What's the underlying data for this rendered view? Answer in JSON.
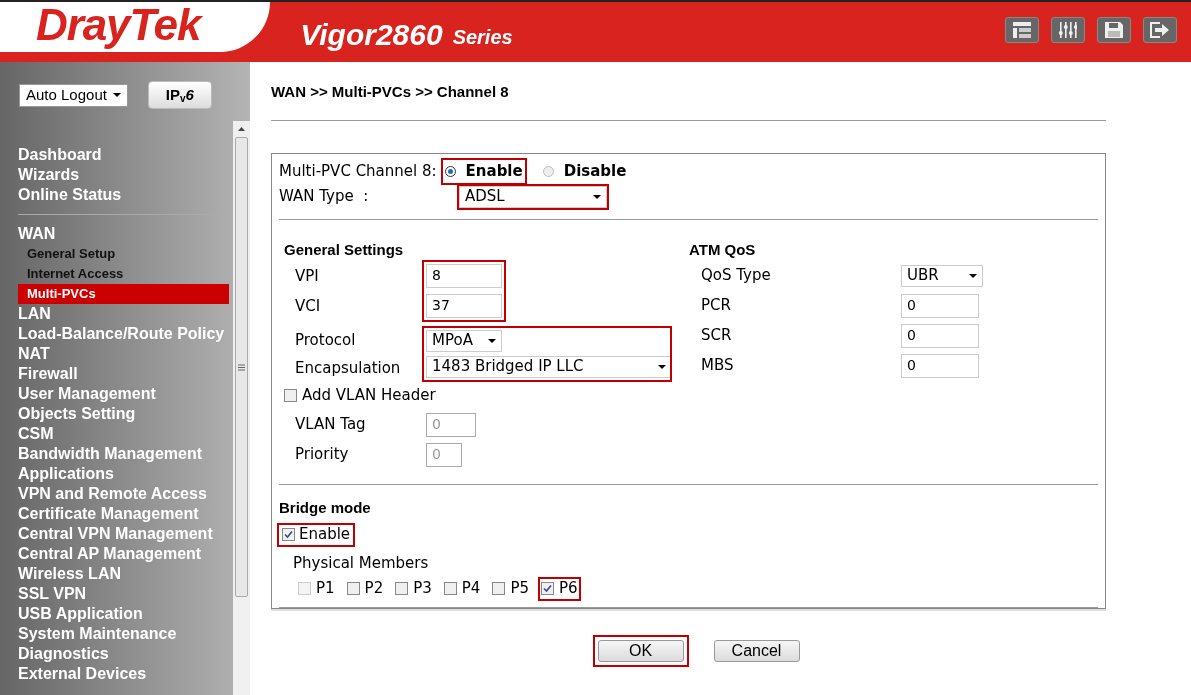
{
  "header": {
    "brand": "DrayTek",
    "model": "Vigor2860",
    "series": "Series"
  },
  "sidebar": {
    "auto_logout": "Auto Logout",
    "ipv6_button": "IP$_{v}$*6*",
    "items": [
      {
        "label": "Dashboard",
        "kind": "main",
        "selected": false
      },
      {
        "label": "Wizards",
        "kind": "main",
        "selected": false
      },
      {
        "label": "Online Status",
        "kind": "main",
        "selected": false
      },
      {
        "kind": "divider"
      },
      {
        "label": "WAN",
        "kind": "main",
        "selected": false
      },
      {
        "label": "General Setup",
        "kind": "sub",
        "selected": false
      },
      {
        "label": "Internet Access",
        "kind": "sub",
        "selected": false
      },
      {
        "label": "Multi-PVCs",
        "kind": "sub",
        "selected": true
      },
      {
        "label": "LAN",
        "kind": "main",
        "selected": false
      },
      {
        "label": "Load-Balance/Route Policy",
        "kind": "main",
        "selected": false
      },
      {
        "label": "NAT",
        "kind": "main",
        "selected": false
      },
      {
        "label": "Firewall",
        "kind": "main",
        "selected": false
      },
      {
        "label": "User Management",
        "kind": "main",
        "selected": false
      },
      {
        "label": "Objects Setting",
        "kind": "main",
        "selected": false
      },
      {
        "label": "CSM",
        "kind": "main",
        "selected": false
      },
      {
        "label": "Bandwidth Management",
        "kind": "main",
        "selected": false
      },
      {
        "label": "Applications",
        "kind": "main",
        "selected": false
      },
      {
        "label": "VPN and Remote Access",
        "kind": "main",
        "selected": false
      },
      {
        "label": "Certificate Management",
        "kind": "main",
        "selected": false
      },
      {
        "label": "Central VPN Management",
        "kind": "main",
        "selected": false
      },
      {
        "label": "Central AP Management",
        "kind": "main",
        "selected": false
      },
      {
        "label": "Wireless LAN",
        "kind": "main",
        "selected": false
      },
      {
        "label": "SSL VPN",
        "kind": "main",
        "selected": false
      },
      {
        "label": "USB Application",
        "kind": "main",
        "selected": false
      },
      {
        "label": "System Maintenance",
        "kind": "main",
        "selected": false
      },
      {
        "label": "Diagnostics",
        "kind": "main",
        "selected": false
      },
      {
        "label": "External Devices",
        "kind": "main",
        "selected": false
      }
    ]
  },
  "breadcrumb": "WAN >> Multi-PVCs >> Channel 8",
  "channel": {
    "label": "Multi-PVC Channel 8:",
    "options": [
      {
        "label": "Enable",
        "selected": true,
        "highlighted": true
      },
      {
        "label": "Disable",
        "selected": false,
        "highlighted": false
      }
    ]
  },
  "wan_type": {
    "label": "WAN Type  :",
    "value": "ADSL",
    "highlighted": true
  },
  "general": {
    "title": "General Settings",
    "vpi": {
      "label": "VPI",
      "value": "8"
    },
    "vci": {
      "label": "VCI",
      "value": "37"
    },
    "protocol": {
      "label": "Protocol",
      "value": "MPoA"
    },
    "encapsulation": {
      "label": "Encapsulation",
      "value": "1483 Bridged IP LLC"
    },
    "vlan_header": {
      "label": "Add VLAN Header",
      "checked": false
    },
    "vlan_tag": {
      "label": "VLAN Tag",
      "value": "0",
      "disabled": true
    },
    "priority": {
      "label": "Priority",
      "value": "0",
      "disabled": true
    }
  },
  "atm_qos": {
    "title": "ATM QoS",
    "qos_type": {
      "label": "QoS Type",
      "value": "UBR"
    },
    "fields": [
      {
        "label": "PCR",
        "value": "0"
      },
      {
        "label": "SCR",
        "value": "0"
      },
      {
        "label": "MBS",
        "value": "0"
      }
    ]
  },
  "bridge": {
    "title": "Bridge mode",
    "enable": {
      "label": "Enable",
      "checked": true,
      "highlighted": true
    },
    "members_label": "Physical Members",
    "members": [
      {
        "label": "P1",
        "checked": false,
        "disabled": true,
        "highlighted": false
      },
      {
        "label": "P2",
        "checked": false,
        "disabled": false,
        "highlighted": false
      },
      {
        "label": "P3",
        "checked": false,
        "disabled": false,
        "highlighted": false
      },
      {
        "label": "P4",
        "checked": false,
        "disabled": false,
        "highlighted": false
      },
      {
        "label": "P5",
        "checked": false,
        "disabled": false,
        "highlighted": false
      },
      {
        "label": "P6",
        "checked": true,
        "disabled": false,
        "highlighted": true
      }
    ]
  },
  "buttons": [
    {
      "label": "OK",
      "highlighted": true
    },
    {
      "label": "Cancel",
      "highlighted": false
    }
  ]
}
